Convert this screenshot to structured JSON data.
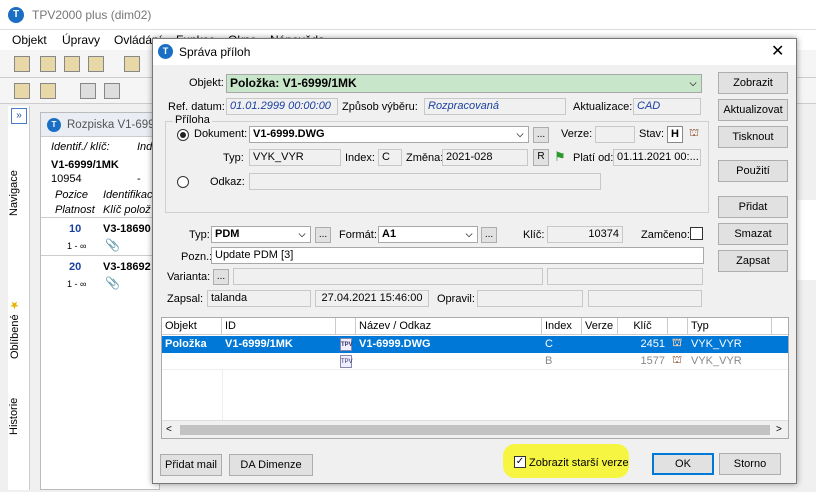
{
  "app": {
    "title": "TPV2000 plus (dim02)",
    "menu": [
      "Objekt",
      "Úpravy",
      "Ovládání",
      "Funkce",
      "Okno",
      "Nápověda"
    ]
  },
  "sidebar": {
    "tabs": [
      "Navigace",
      "Oblíbené",
      "Historie"
    ]
  },
  "rozpiska": {
    "title": "Rozpiska V1-699",
    "col1": "Identif./ klíč:",
    "col1b": "Ind",
    "item": "V1-6999/1MK",
    "num": "10954",
    "dash": "-",
    "h1": "Pozice",
    "h1b": "Identifikac",
    "h2": "Platnost",
    "h2b": "Klíč polož",
    "rows": [
      {
        "pos": "10",
        "id": "V3-18690",
        "range": "1 - ∞"
      },
      {
        "pos": "20",
        "id": "V3-18692",
        "range": "1 - ∞"
      }
    ]
  },
  "dialog": {
    "title": "Správa příloh",
    "objekt_label": "Objekt:",
    "objekt_value": "Položka: V1-6999/1MK",
    "ref_label": "Ref. datum:",
    "ref_value": "01.01.2999 00:00:00",
    "zpusob_label": "Způsob výběru:",
    "zpusob_value": "Rozpracovaná",
    "aktual_label": "Aktualizace:",
    "aktual_value": "CAD",
    "group_label": "Příloha",
    "dokument_label": "Dokument:",
    "dokument_value": "V1-6999.DWG",
    "verze_label": "Verze:",
    "verze_value": "",
    "stav_label": "Stav:",
    "stav_value": "H",
    "typ1_label": "Typ:",
    "typ1_value": "VYK_VYR",
    "index_label": "Index:",
    "index_value": "C",
    "zmena_label": "Změna:",
    "zmena_value": "2021-028",
    "r_value": "R",
    "platnost_label": "Platí od:",
    "platnost_value": "01.11.2021 00:...",
    "odkaz_label": "Odkaz:",
    "odkaz_value": "",
    "typ2_label": "Typ:",
    "typ2_value": "PDM",
    "format_label": "Formát:",
    "format_value": "A1",
    "klic_label": "Klíč:",
    "klic_value": "10374",
    "zamceno_label": "Zamčeno:",
    "pozn_label": "Pozn.:",
    "pozn_value": "Update PDM [3]",
    "varianta_label": "Varianta:",
    "zapsal_label": "Zapsal:",
    "zapsal_value": "talanda",
    "zapsal_date": "27.04.2021 15:46:00",
    "opravil_label": "Opravil:",
    "ellipsis": "...",
    "buttons": {
      "zobrazit": "Zobrazit",
      "aktualizovat": "Aktualizovat",
      "tisknout": "Tisknout",
      "pouziti": "Použití",
      "pridat": "Přidat",
      "smazat": "Smazat",
      "zapsat": "Zapsat",
      "pridat_mail": "Přidat mail",
      "da_dimenze": "DA Dimenze",
      "ok": "OK",
      "storno": "Storno"
    },
    "checkbox_label": "Zobrazit starší verze",
    "grid": {
      "headers": [
        "Objekt",
        "ID",
        "",
        "Název / Odkaz",
        "Index",
        "Verze",
        "Klíč",
        "",
        "Typ"
      ],
      "rows": [
        {
          "objekt": "Položka",
          "id": "V1-6999/1MK",
          "nazev": "V1-6999.DWG",
          "index": "C",
          "verze": "",
          "klic": "2451",
          "typ": "VYK_VYR"
        },
        {
          "objekt": "",
          "id": "",
          "nazev": "",
          "index": "B",
          "verze": "",
          "klic": "1577",
          "typ": "VYK_VYR"
        }
      ]
    }
  },
  "colors": {
    "accent": "#0078d7",
    "objekt_bg": "#c8e6c9",
    "highlight": "#f5f542"
  }
}
